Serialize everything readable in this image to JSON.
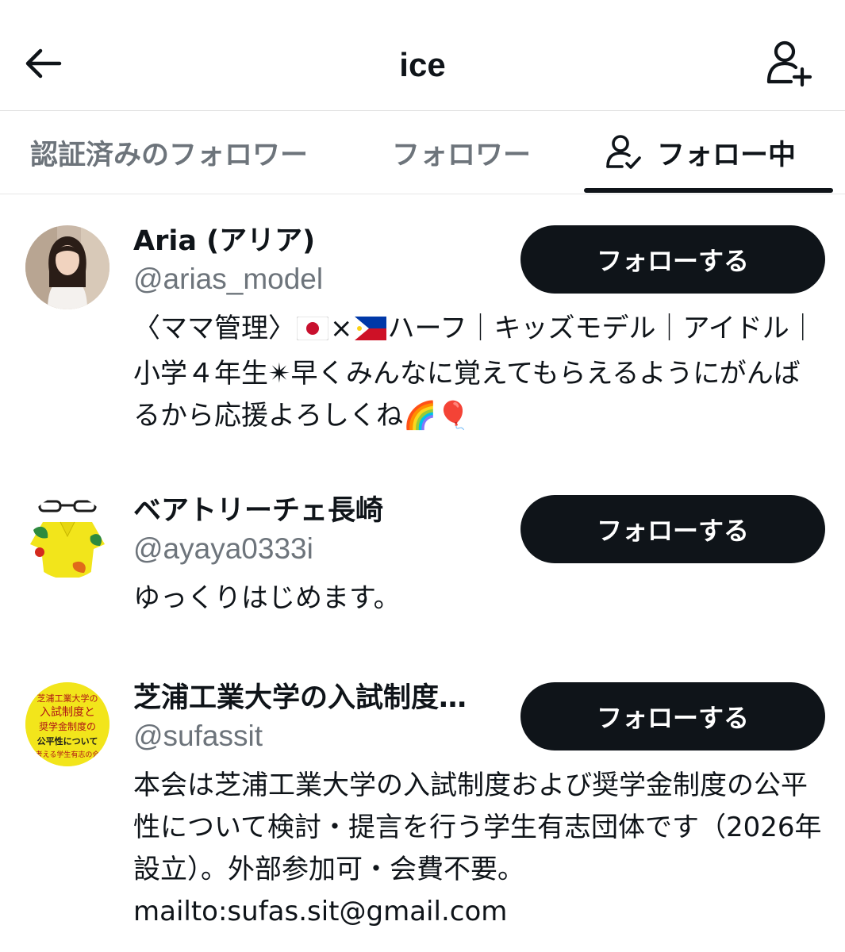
{
  "header": {
    "title": "ice",
    "back_icon": "arrow-left-icon",
    "add_user_icon": "person-plus-icon"
  },
  "tabs": [
    {
      "label": "認証済みのフォロワー",
      "active": false
    },
    {
      "label": "フォロワー",
      "active": false
    },
    {
      "label": "フォロー中",
      "active": true,
      "icon": "person-check-icon"
    }
  ],
  "users": [
    {
      "name": "Aria (アリア)",
      "handle": "@arias_model",
      "follow_label": "フォローする",
      "bio_pre": "〈ママ管理〉",
      "bio_x": "×",
      "bio_post": "ハーフ｜キッズモデル｜アイドル｜小学４年生✴︎早くみんなに覚えてもらえるようにがんばるから応援よろしくね",
      "bio_emoji": "🌈🎈"
    },
    {
      "name": "ベアトリーチェ長崎",
      "handle": "@ayaya0333i",
      "follow_label": "フォローする",
      "bio": "ゆっくりはじめます。"
    },
    {
      "name": "芝浦工業大学の入試制度…",
      "handle": "@sufassit",
      "follow_label": "フォローする",
      "bio": "本会は芝浦工業大学の入試制度および奨学金制度の公平性について検討・提言を行う学生有志団体です（2026年設立）。外部参加可・会費不要。mailto:sufas.sit@gmail.com",
      "avatar_text": [
        "芝浦工業大学の",
        "入試制度と",
        "奨学金制度の",
        "公平性について",
        "考える学生有志の会"
      ]
    }
  ],
  "colors": {
    "primary_text": "#0f1419",
    "secondary_text": "#6d747b",
    "button_bg": "#0f1419",
    "button_text": "#ffffff",
    "avatar3_bg": "#f2e51b"
  }
}
